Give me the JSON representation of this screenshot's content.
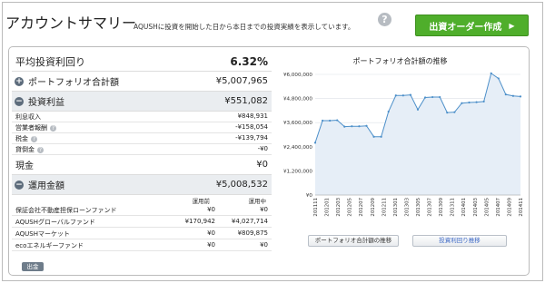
{
  "header": {
    "title": "アカウントサマリー",
    "subtitle": "AQUSHに投資を開始した日から本日までの投資実績を表示しています。",
    "help": "?",
    "order_button": "出資オーダー作成",
    "order_arrow": "▶"
  },
  "summary": {
    "avg_yield_label": "平均投資利回り",
    "avg_yield_value": "6.32%",
    "portfolio_label": "ポートフォリオ合計額",
    "portfolio_value": "¥5,007,965",
    "profit_label": "投資利益",
    "profit_value": "¥551,082",
    "profit_items": [
      {
        "label": "利息収入",
        "value": "¥848,931",
        "help": false
      },
      {
        "label": "営業者報酬",
        "value": "-¥158,054",
        "help": true
      },
      {
        "label": "税金",
        "value": "-¥139,794",
        "help": true
      },
      {
        "label": "貸倒金",
        "value": "-¥0",
        "help": true
      }
    ],
    "cash_label": "現金",
    "cash_value": "¥0",
    "fund_label": "運用金額",
    "fund_value": "¥5,008,532",
    "fund_col1": "運用前",
    "fund_col2": "運用中",
    "funds": [
      {
        "name": "保証会社不動産担保ローンファンド",
        "before": "¥0",
        "during": "¥0"
      },
      {
        "name": "AQUSHグローバルファンド",
        "before": "¥170,942",
        "during": "¥4,027,714"
      },
      {
        "name": "AQUSHマーケット",
        "before": "¥0",
        "during": "¥809,875"
      },
      {
        "name": "ecoエネルギーファンド",
        "before": "¥0",
        "during": "¥0"
      }
    ],
    "withdraw_button": "出金"
  },
  "chart_data": {
    "type": "area",
    "title": "ポートフォリオ合計額の推移",
    "ylim": [
      0,
      6000000
    ],
    "y_ticks": [
      "¥6,000,000",
      "¥4,800,000",
      "¥3,600,000",
      "¥2,400,000",
      "¥1,200,000",
      "¥0"
    ],
    "y_tick_values": [
      6000000,
      4800000,
      3600000,
      2400000,
      1200000,
      0
    ],
    "x_tick_labels": [
      "201111",
      "201201",
      "201203",
      "201205",
      "201207",
      "201209",
      "201211",
      "201301",
      "201303",
      "201305",
      "201307",
      "201309",
      "201311",
      "201401",
      "201403",
      "201405",
      "201407",
      "201409",
      "201411"
    ],
    "values": [
      2600000,
      3700000,
      3700000,
      3720000,
      3400000,
      3420000,
      3420000,
      3440000,
      2900000,
      2900000,
      4150000,
      4950000,
      4950000,
      4980000,
      4250000,
      4850000,
      4870000,
      4870000,
      4100000,
      4120000,
      4570000,
      4600000,
      4620000,
      4650000,
      6050000,
      5800000,
      5000000,
      4930000,
      4900000
    ],
    "grid": true,
    "color": "#4c8fc9",
    "fill": "#e6eef7"
  },
  "chart_buttons": {
    "left": "ポートフォリオ合計額の推移",
    "right": "投資利回り推移"
  }
}
